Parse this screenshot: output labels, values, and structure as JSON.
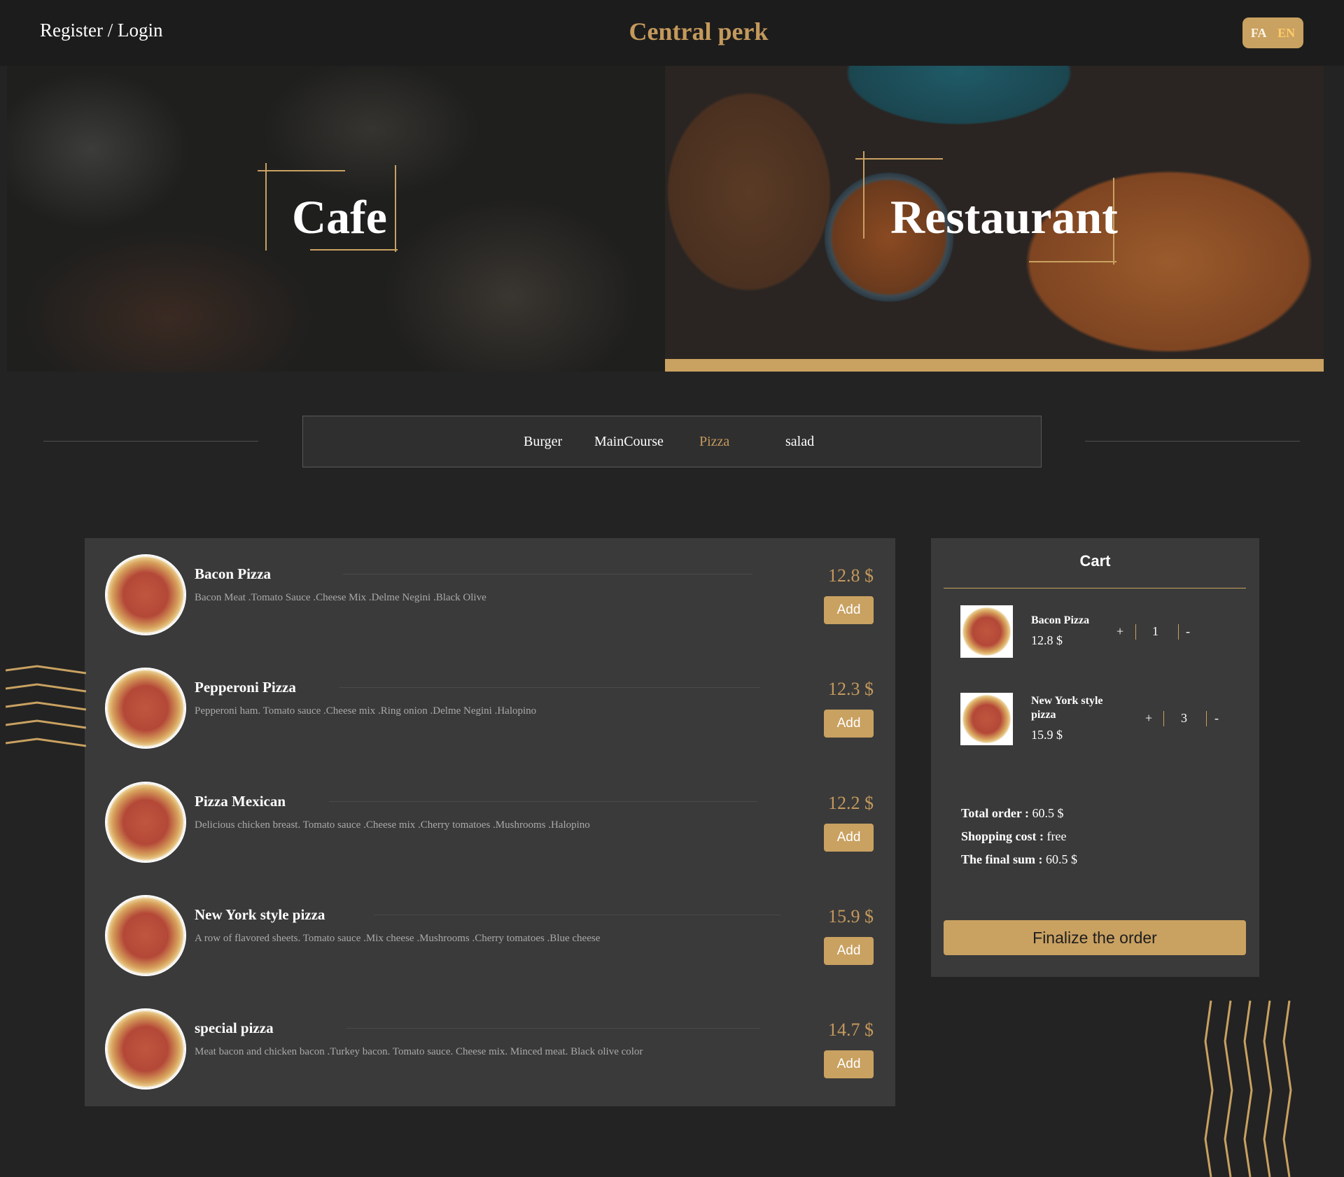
{
  "header": {
    "login_label": "Register / Login",
    "brand": "Central perk",
    "lang": {
      "fa": "FA",
      "en": "EN",
      "active": "EN"
    }
  },
  "hero": {
    "cafe_label": "Cafe",
    "restaurant_label": "Restaurant"
  },
  "categories": {
    "items": [
      "Burger",
      "MainCourse",
      "Pizza",
      "salad"
    ],
    "active": "Pizza"
  },
  "menu": {
    "items": [
      {
        "name": "Bacon Pizza",
        "desc": "Bacon Meat .Tomato Sauce .Cheese Mix .Delme Negini .Black Olive",
        "price": "12.8 $",
        "add_label": "Add"
      },
      {
        "name": "Pepperoni Pizza",
        "desc": "Pepperoni ham. Tomato sauce .Cheese mix .Ring onion .Delme Negini .Halopino",
        "price": "12.3 $",
        "add_label": "Add"
      },
      {
        "name": "Pizza Mexican",
        "desc": "Delicious chicken breast. Tomato sauce .Cheese mix .Cherry tomatoes .Mushrooms .Halopino",
        "price": "12.2 $",
        "add_label": "Add"
      },
      {
        "name": "New York style pizza",
        "desc": "A row of flavored sheets. Tomato sauce .Mix cheese .Mushrooms .Cherry tomatoes .Blue cheese",
        "price": "15.9 $",
        "add_label": "Add"
      },
      {
        "name": "special pizza",
        "desc": "Meat bacon and chicken bacon .Turkey bacon. Tomato sauce. Cheese mix. Minced meat. Black olive color",
        "price": "14.7 $",
        "add_label": "Add"
      }
    ]
  },
  "cart": {
    "title": "Cart",
    "items": [
      {
        "name": "Bacon Pizza",
        "price": "12.8 $",
        "qty": "1",
        "plus": "+",
        "minus": "-"
      },
      {
        "name": "New York style pizza",
        "price": "15.9 $",
        "qty": "3",
        "plus": "+",
        "minus": "-"
      }
    ],
    "total_label": "Total order :",
    "total_value": "60.5 $",
    "shipping_label": "Shopping cost :",
    "shipping_value": "free",
    "final_label": "The final sum :",
    "final_value": "60.5 $",
    "finalize_label": "Finalize the order"
  },
  "colors": {
    "accent": "#c9a161",
    "accent_text": "#c4995c",
    "background": "#232323",
    "panel": "#3a3a3a"
  }
}
